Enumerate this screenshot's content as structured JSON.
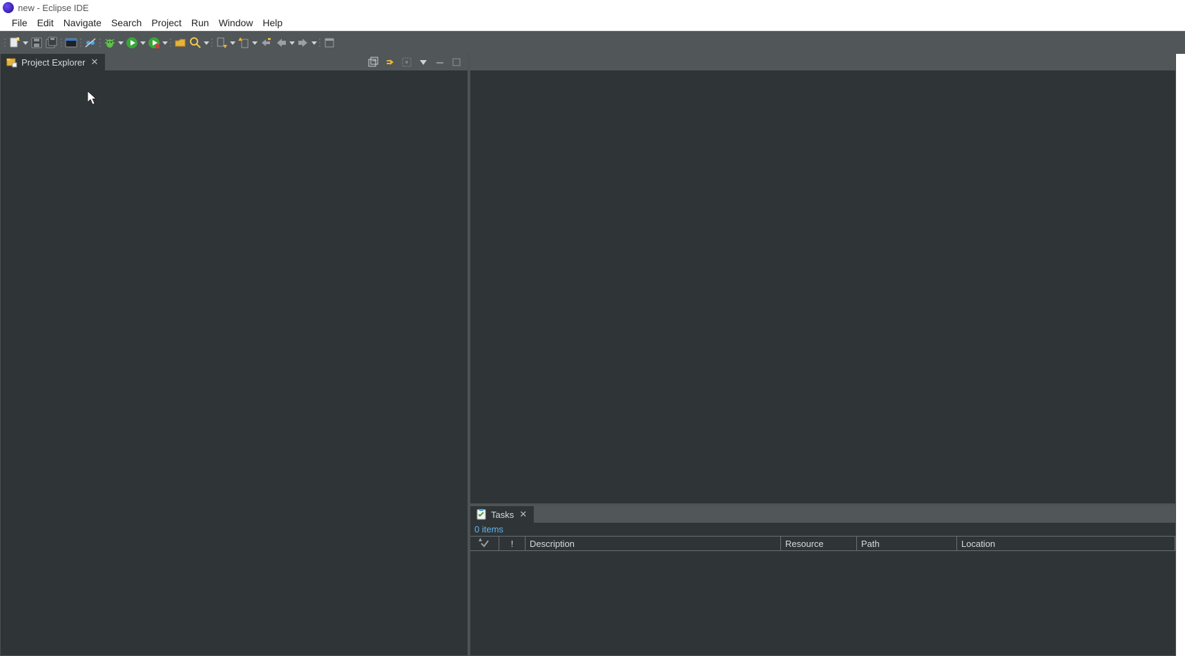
{
  "window": {
    "title": "new - Eclipse IDE"
  },
  "menu": {
    "items": [
      "File",
      "Edit",
      "Navigate",
      "Search",
      "Project",
      "Run",
      "Window",
      "Help"
    ]
  },
  "views": {
    "project_explorer": {
      "label": "Project Explorer"
    },
    "tasks": {
      "label": "Tasks",
      "status": "0 items",
      "columns": {
        "bang": "!",
        "description": "Description",
        "resource": "Resource",
        "path": "Path",
        "location": "Location"
      }
    }
  }
}
